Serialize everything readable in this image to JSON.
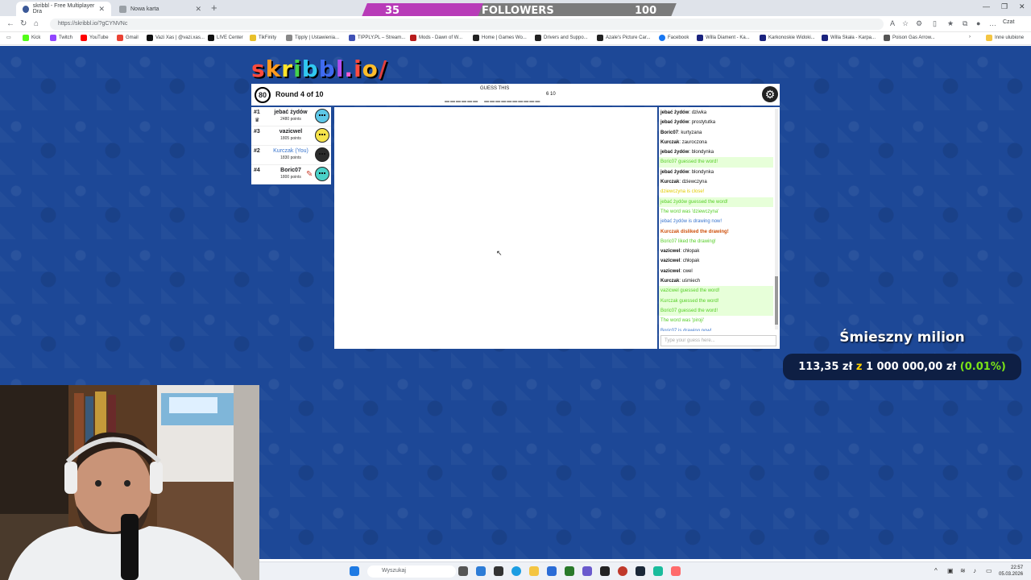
{
  "browser": {
    "tabs": [
      {
        "title": "skribbl - Free Multiplayer Dra",
        "active": true
      },
      {
        "title": "Nowa karta",
        "active": false
      }
    ],
    "url": "https://skribbl.io/?gCYNVNc",
    "chat_extension": "Czat",
    "bookmarks": [
      "Kick",
      "Twitch",
      "YouTube",
      "Gmail",
      "Vazi Xas | @vazi.xas...",
      "LIVE Center",
      "TikFinity",
      "Tipply | Ustawienia...",
      "TIPPLY.PL – Stream...",
      "Mods - Dawn of W...",
      "Home | Games Wo...",
      "Drivers and Suppo...",
      "Azale's Picture Car...",
      "Facebook",
      "Willa Diament - Ka...",
      "Karkonoskie Widoki...",
      "Willa Skała - Karpa...",
      "Poison Gas Arrow..."
    ],
    "other_bookmarks": "Inne ulubione"
  },
  "followers": {
    "current": "35",
    "label": "FOLLOWERS",
    "goal": "100"
  },
  "game": {
    "logo": "skribbl.io/",
    "timer": "80",
    "round": "Round 4 of 10",
    "guess_label": "GUESS THIS",
    "word_pattern": "______  __________",
    "word_lengths": "6 10",
    "players": [
      {
        "rank": "#1",
        "name": "jebać żydów",
        "points": "2480 points",
        "you": false,
        "crown": true,
        "drawing": false,
        "avatar_color": "#5ec8e8"
      },
      {
        "rank": "#3",
        "name": "vazicwel",
        "points": "1805 points",
        "you": false,
        "crown": false,
        "drawing": false,
        "avatar_color": "#f6e34a"
      },
      {
        "rank": "#2",
        "name": "Kurczak (You)",
        "points": "1830 points",
        "you": true,
        "crown": false,
        "drawing": false,
        "avatar_color": "#2b2b2b"
      },
      {
        "rank": "#4",
        "name": "Boric07",
        "points": "1800 points",
        "you": false,
        "crown": false,
        "drawing": true,
        "avatar_color": "#4ad1c8"
      }
    ],
    "chat": [
      {
        "user": "jebać żydów",
        "text": "dziwka",
        "type": "normal"
      },
      {
        "user": "jebać żydów",
        "text": "prostytutka",
        "type": "normal"
      },
      {
        "user": "Boric07",
        "text": "kurtyzana",
        "type": "normal"
      },
      {
        "user": "Kurczak",
        "text": "zauroczona",
        "type": "normal"
      },
      {
        "user": "jebać żydów",
        "text": "blondynka",
        "type": "normal"
      },
      {
        "user": "",
        "text": "Boric07 guessed the word!",
        "type": "guessed"
      },
      {
        "user": "jebać żydów",
        "text": "blondynka",
        "type": "normal"
      },
      {
        "user": "Kurczak",
        "text": "dziewczyna",
        "type": "normal"
      },
      {
        "user": "",
        "text": "dziewczyna is close!",
        "type": "close"
      },
      {
        "user": "",
        "text": "jebać żydów guessed the word!",
        "type": "guessed"
      },
      {
        "user": "",
        "text": "The word was 'dziewczyna'",
        "type": "word"
      },
      {
        "user": "",
        "text": "jebać żydów is drawing now!",
        "type": "drawing"
      },
      {
        "user": "",
        "text": "Kurczak disliked the drawing!",
        "type": "dislike"
      },
      {
        "user": "",
        "text": "Boric07 liked the drawing!",
        "type": "like"
      },
      {
        "user": "vazicwel",
        "text": "chłopak",
        "type": "normal"
      },
      {
        "user": "vazicwel",
        "text": "chłopak",
        "type": "normal"
      },
      {
        "user": "vazicwel",
        "text": "cwel",
        "type": "normal"
      },
      {
        "user": "Kurczak",
        "text": "uśmiech",
        "type": "normal"
      },
      {
        "user": "",
        "text": "vazicwel guessed the word!",
        "type": "guessed"
      },
      {
        "user": "",
        "text": "Kurczak guessed the word!",
        "type": "guessed"
      },
      {
        "user": "",
        "text": "Boric07 guessed the word!",
        "type": "guessed"
      },
      {
        "user": "",
        "text": "The word was 'piroji'",
        "type": "word"
      },
      {
        "user": "",
        "text": "Boric07 is drawing now!",
        "type": "drawing"
      }
    ],
    "chat_placeholder": "Type your guess here..."
  },
  "overlay": {
    "title": "Śmieszny milion",
    "amount": "113,35 zł",
    "z": "z",
    "goal": "1 000 000,00 zł",
    "percent": "(0.01%)"
  },
  "taskbar": {
    "search_placeholder": "Wyszukaj",
    "time": "22:57",
    "date": "05.03.2026"
  },
  "colors": {
    "page_blue": "#1d4897",
    "followers_purple": "#b83bb8",
    "followers_gray": "#7b7b7b",
    "chat_guessed": "#56ce27",
    "chat_guessed_bg": "#e7ffd9",
    "chat_close": "#e2cb00",
    "chat_drawing": "#3975ce",
    "chat_dislike": "#ce4f0a",
    "chat_word": "#56ce27"
  }
}
